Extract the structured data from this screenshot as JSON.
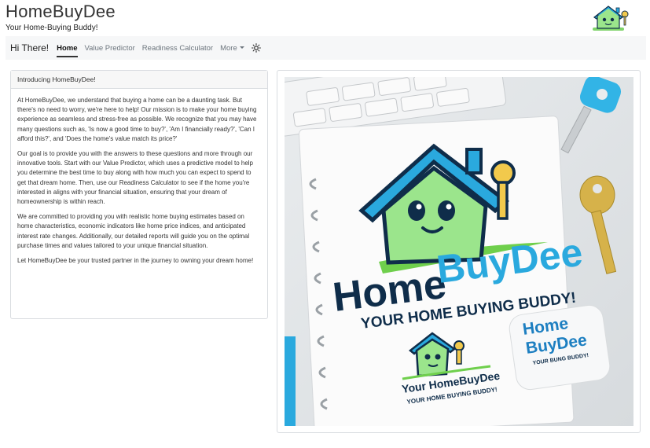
{
  "app": {
    "title": "HomeBuyDee",
    "tagline": "Your Home-Buying Buddy!"
  },
  "nav": {
    "brand": "Hi There!",
    "links": [
      {
        "label": "Home",
        "active": true
      },
      {
        "label": "Value Predictor",
        "active": false
      },
      {
        "label": "Readiness Calculator",
        "active": false
      },
      {
        "label": "More",
        "active": false
      }
    ],
    "theme_icon": "sun-icon"
  },
  "intro_card": {
    "header": "Introducing HomeBuyDee!",
    "paragraphs": [
      "At HomeBuyDee, we understand that buying a home can be a daunting task. But there's no need to worry, we're here to help! Our mission is to make your home buying experience as seamless and stress-free as possible. We recognize that you may have many questions such as, 'Is now a good time to buy?', 'Am I financially ready?', 'Can I afford this?', and 'Does the home's value match its price?'",
      "Our goal is to provide you with the answers to these questions and more through our innovative tools. Start with our Value Predictor, which uses a predictive model to help you determine the best time to buy along with how much you can expect to spend to get that dream home. Then, use our Readiness Calculator to see if the home you're interested in aligns with your financial situation, ensuring that your dream of homeownership is within reach.",
      "We are committed to providing you with realistic home buying estimates based on home characteristics, economic indicators like home price indices, and anticipated interest rate changes. Additionally, our detailed reports will guide you on the optimal purchase times and values tailored to your unique financial situation.",
      "Let HomeBuyDee be your trusted partner in the journey to owning your dream home!"
    ]
  },
  "hero_image": {
    "logo_word_1": "Home",
    "logo_word_2": "BuyDee",
    "logo_tagline": "YOUR HOME BUYING BUDDY!",
    "small_logo_text": "Your HomeBuyDee",
    "small_logo_tagline": "YOUR HOME BUYING BUDDY!",
    "sticker_line_1": "Home",
    "sticker_line_2": "BuyDee",
    "sticker_tagline": "YOUR BUNG BUDDY!",
    "keyboard_keys": [
      "",
      "",
      "",
      "",
      ""
    ],
    "colors": {
      "blue": "#2aa9de",
      "navy": "#0f2d4a",
      "green": "#9be58c",
      "key_gold": "#d6b24a",
      "key_blue": "#32b4e6"
    }
  }
}
